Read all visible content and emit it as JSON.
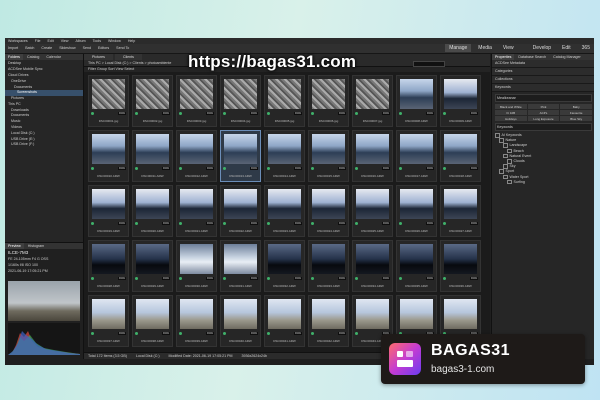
{
  "window": {
    "menu": [
      "Workspaces",
      "File",
      "Edit",
      "View",
      "Album",
      "Tools",
      "Window",
      "Help"
    ],
    "title": "",
    "toolbar": [
      "Import",
      "Batch",
      "Create",
      "Slideshow",
      "Send",
      "Editors",
      "Send To"
    ],
    "modes": [
      "Manage",
      "Media",
      "View",
      "Develop",
      "Edit",
      "365"
    ]
  },
  "left_panel": {
    "tabs": [
      "Folders",
      "Catalog",
      "Calendar"
    ],
    "folders": [
      "Desktop",
      "ACDSee Mobile Sync",
      "Cloud Drives",
      "OneDrive",
      "Documents",
      "Screenshots",
      "Pictures",
      "This PC",
      "Downloads",
      "Documents",
      "Music",
      "Videos",
      "Local Disk (C:)",
      "USB Drive (E:)",
      "USB Drive (F:)"
    ],
    "selected_folder_index": 5,
    "preview": {
      "tabs": [
        "Preview",
        "Histogram"
      ],
      "camera": "ILCE-7M3",
      "lens": "FE 24-105mm F4 G OSS",
      "settings": "1/160s  f/8  ISO 100",
      "date": "2021-06-19 17:05:21 PM"
    }
  },
  "center": {
    "tabs": [
      "Pictures",
      "Clients"
    ],
    "breadcrumb": "This PC  >  Local Disk (C:)  >  Clients  >  photoambiente",
    "filter_bar": "Filter   Group   Sort   View   Select",
    "rows": [
      {
        "style": "rock",
        "names": [
          "DSC00001.jpg",
          "DSC00002.jpg",
          "DSC00003.jpg",
          "DSC00004.jpg",
          "DSC00005.jpg",
          "DSC00006.jpg",
          "DSC00007.jpg",
          "DSC00008.ARW",
          "DSC00009.ARW"
        ]
      },
      {
        "style": "sky",
        "names": [
          "DSC00010.ARW",
          "DSC00011.ARW",
          "DSC00012.ARW",
          "DSC00013.ARW",
          "DSC00014.ARW",
          "DSC00015.ARW",
          "DSC00016.ARW",
          "DSC00017.ARW",
          "DSC00018.ARW"
        ]
      },
      {
        "style": "dusk",
        "names": [
          "DSC00019.ARW",
          "DSC00020.ARW",
          "DSC00021.ARW",
          "DSC00022.ARW",
          "DSC00023.ARW",
          "DSC00024.ARW",
          "DSC00025.ARW",
          "DSC00026.ARW",
          "DSC00027.ARW"
        ]
      },
      {
        "style": "dark",
        "names": [
          "DSC00028.ARW",
          "DSC00029.ARW",
          "DSC00030.ARW",
          "DSC00031.ARW",
          "DSC00032.ARW",
          "DSC00033.ARW",
          "DSC00034.ARW",
          "DSC00035.ARW",
          "DSC00036.ARW"
        ]
      },
      {
        "style": "beach",
        "names": [
          "DSC00037.ARW",
          "DSC00038.ARW",
          "DSC00039.ARW",
          "DSC00040.ARW",
          "DSC00041.ARW",
          "DSC00042.ARW",
          "DSC00043.ARW",
          "DSC00044.ARW",
          "DSC00045.ARW"
        ]
      }
    ],
    "badge": "RAW"
  },
  "status_bar": [
    "Total 172 Items (3.5 GB)",
    "Local Disk (C:)",
    "Modified Date: 2021-06-19 17:05:21 PM",
    "3936x2624x24b"
  ],
  "right_panel": {
    "tabs": [
      "Properties",
      "Database Search",
      "Catalog Manager"
    ],
    "sections": [
      "ACDSee Metadata",
      "Categories",
      "Collections",
      "Keywords"
    ],
    "keywords_box": "Mealkeanar",
    "quick_keywords": [
      "Black and White",
      "Pink",
      "Baby",
      "Fi 10B",
      "ACPL",
      "Favourite",
      "Holidays",
      "Long Exposure",
      "Blue Sky"
    ],
    "keyword_field": "Keywords",
    "tree_title": "AI Keywords",
    "tree": [
      "AI Keywords",
      "Nature",
      "Landscape",
      "Beach",
      "Natural Event",
      "Clouds",
      "Sky",
      "Sport",
      "Water Sport",
      "Surfing"
    ]
  },
  "overlay": {
    "url": "https://bagas31.com",
    "brand_name": "BAGAS31",
    "brand_url": "bagas3-1.com"
  },
  "colors": {
    "window_bg": "#1f1f1f",
    "panel_bg": "#262626",
    "selection": "#37506b",
    "background_gradient": [
      "#bfe9e3",
      "#bfe3f3"
    ],
    "logo_gradient": [
      "#ff6b6b",
      "#c43bd2",
      "#6a3cf0"
    ]
  }
}
